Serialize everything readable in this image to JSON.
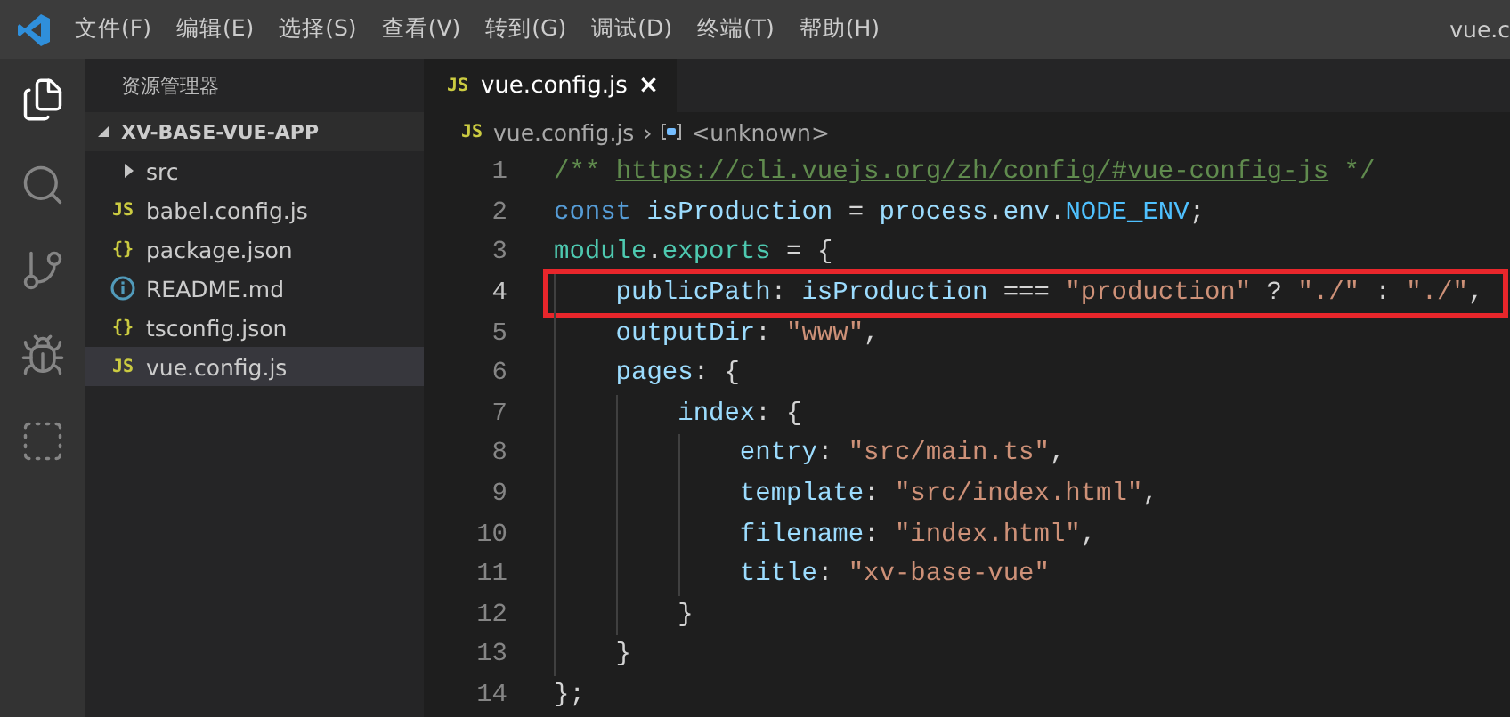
{
  "menu": [
    "文件(F)",
    "编辑(E)",
    "选择(S)",
    "查看(V)",
    "转到(G)",
    "调试(D)",
    "终端(T)",
    "帮助(H)"
  ],
  "window": {
    "title": "vue.c"
  },
  "activity_bar": [
    {
      "kind": "files",
      "selected": true
    },
    {
      "kind": "search",
      "selected": false
    },
    {
      "kind": "git",
      "selected": false
    },
    {
      "kind": "debug",
      "selected": false
    },
    {
      "kind": "extensions",
      "selected": false
    }
  ],
  "sidebar": {
    "title": "资源管理器",
    "root": {
      "label": "XV-BASE-VUE-APP",
      "expanded": true
    },
    "items": [
      {
        "kind": "folder",
        "label": "src",
        "expanded": false,
        "selected": false
      },
      {
        "kind": "js",
        "badge": "JS",
        "label": "babel.config.js",
        "selected": false
      },
      {
        "kind": "json",
        "badge": "{}",
        "label": "package.json",
        "selected": false
      },
      {
        "kind": "info",
        "label": "README.md",
        "selected": false
      },
      {
        "kind": "json",
        "badge": "{}",
        "label": "tsconfig.json",
        "selected": false
      },
      {
        "kind": "js",
        "badge": "JS",
        "label": "vue.config.js",
        "selected": true
      }
    ]
  },
  "tab": {
    "badge": "JS",
    "label": "vue.config.js",
    "close": "×"
  },
  "breadcrumbs": {
    "badge": "JS",
    "file": "vue.config.js",
    "separator": "›",
    "symbol": "<unknown>"
  },
  "code": [
    {
      "number": "1",
      "highlighted": false,
      "tokens": [
        {
          "kind": "comment",
          "text": "/** "
        },
        {
          "kind": "link",
          "text": "https://cli.vuejs.org/zh/config/#vue-config-js"
        },
        {
          "kind": "comment",
          "text": " */"
        }
      ]
    },
    {
      "number": "2",
      "highlighted": false,
      "tokens": [
        {
          "kind": "keyword",
          "text": "const "
        },
        {
          "kind": "variable",
          "text": "isProduction"
        },
        {
          "kind": "plain",
          "text": " = "
        },
        {
          "kind": "variable",
          "text": "process"
        },
        {
          "kind": "plain",
          "text": "."
        },
        {
          "kind": "variable",
          "text": "env"
        },
        {
          "kind": "plain",
          "text": "."
        },
        {
          "kind": "constant",
          "text": "NODE_ENV"
        },
        {
          "kind": "plain",
          "text": ";"
        }
      ]
    },
    {
      "number": "3",
      "highlighted": false,
      "tokens": [
        {
          "kind": "type",
          "text": "module"
        },
        {
          "kind": "plain",
          "text": "."
        },
        {
          "kind": "type",
          "text": "exports"
        },
        {
          "kind": "plain",
          "text": " = {"
        }
      ]
    },
    {
      "number": "4",
      "highlighted": true,
      "tokens": [
        {
          "kind": "variable",
          "text": "    publicPath"
        },
        {
          "kind": "plain",
          "text": ": "
        },
        {
          "kind": "variable",
          "text": "isProduction"
        },
        {
          "kind": "plain",
          "text": " === "
        },
        {
          "kind": "string",
          "text": "\"production\""
        },
        {
          "kind": "plain",
          "text": " ? "
        },
        {
          "kind": "string",
          "text": "\"./\""
        },
        {
          "kind": "plain",
          "text": " : "
        },
        {
          "kind": "string",
          "text": "\"./\""
        },
        {
          "kind": "plain",
          "text": ","
        }
      ]
    },
    {
      "number": "5",
      "highlighted": false,
      "tokens": [
        {
          "kind": "variable",
          "text": "    outputDir"
        },
        {
          "kind": "plain",
          "text": ": "
        },
        {
          "kind": "string",
          "text": "\"www\""
        },
        {
          "kind": "plain",
          "text": ","
        }
      ]
    },
    {
      "number": "6",
      "highlighted": false,
      "tokens": [
        {
          "kind": "variable",
          "text": "    pages"
        },
        {
          "kind": "plain",
          "text": ": {"
        }
      ]
    },
    {
      "number": "7",
      "highlighted": false,
      "tokens": [
        {
          "kind": "variable",
          "text": "        index"
        },
        {
          "kind": "plain",
          "text": ": {"
        }
      ]
    },
    {
      "number": "8",
      "highlighted": false,
      "tokens": [
        {
          "kind": "variable",
          "text": "            entry"
        },
        {
          "kind": "plain",
          "text": ": "
        },
        {
          "kind": "string",
          "text": "\"src/main.ts\""
        },
        {
          "kind": "plain",
          "text": ","
        }
      ]
    },
    {
      "number": "9",
      "highlighted": false,
      "tokens": [
        {
          "kind": "variable",
          "text": "            template"
        },
        {
          "kind": "plain",
          "text": ": "
        },
        {
          "kind": "string",
          "text": "\"src/index.html\""
        },
        {
          "kind": "plain",
          "text": ","
        }
      ]
    },
    {
      "number": "10",
      "highlighted": false,
      "tokens": [
        {
          "kind": "variable",
          "text": "            filename"
        },
        {
          "kind": "plain",
          "text": ": "
        },
        {
          "kind": "string",
          "text": "\"index.html\""
        },
        {
          "kind": "plain",
          "text": ","
        }
      ]
    },
    {
      "number": "11",
      "highlighted": false,
      "tokens": [
        {
          "kind": "variable",
          "text": "            title"
        },
        {
          "kind": "plain",
          "text": ": "
        },
        {
          "kind": "string",
          "text": "\"xv-base-vue\""
        }
      ]
    },
    {
      "number": "12",
      "highlighted": false,
      "tokens": [
        {
          "kind": "plain",
          "text": "        }"
        }
      ]
    },
    {
      "number": "13",
      "highlighted": false,
      "tokens": [
        {
          "kind": "plain",
          "text": "    }"
        }
      ]
    },
    {
      "number": "14",
      "highlighted": false,
      "tokens": [
        {
          "kind": "plain",
          "text": "};"
        }
      ]
    }
  ]
}
